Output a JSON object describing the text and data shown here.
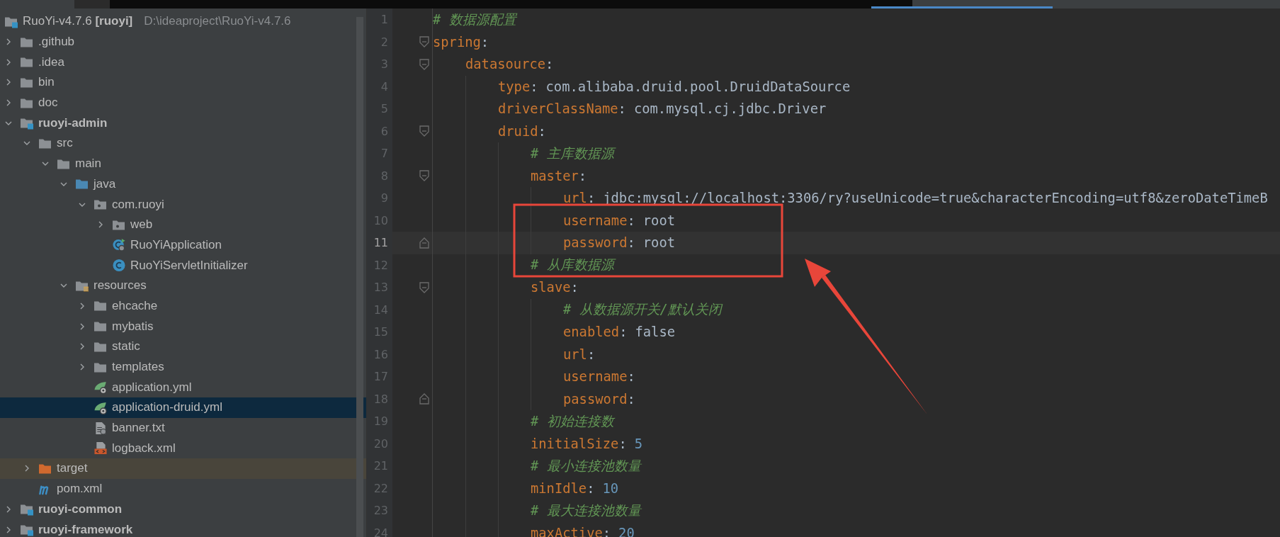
{
  "project": {
    "name": "RuoYi-v4.7.6",
    "module": "[ruoyi]",
    "path": "D:\\ideaproject\\RuoYi-v4.7.6",
    "selected": false,
    "children": [
      {
        "name": ".github",
        "kind": "folder",
        "expanded": false,
        "selected": false
      },
      {
        "name": ".idea",
        "kind": "folder",
        "expanded": false,
        "selected": false
      },
      {
        "name": "bin",
        "kind": "folder",
        "expanded": false,
        "selected": false
      },
      {
        "name": "doc",
        "kind": "folder",
        "expanded": false,
        "selected": false
      },
      {
        "name": "ruoyi-admin",
        "kind": "module",
        "expanded": true,
        "selected": false,
        "children": [
          {
            "name": "src",
            "kind": "folder",
            "expanded": true,
            "selected": false,
            "children": [
              {
                "name": "main",
                "kind": "folder",
                "expanded": true,
                "selected": false,
                "children": [
                  {
                    "name": "java",
                    "kind": "source-root",
                    "expanded": true,
                    "selected": false,
                    "children": [
                      {
                        "name": "com.ruoyi",
                        "kind": "package",
                        "expanded": true,
                        "selected": false,
                        "children": [
                          {
                            "name": "web",
                            "kind": "package",
                            "expanded": false,
                            "selected": false
                          },
                          {
                            "name": "RuoYiApplication",
                            "kind": "main-class",
                            "selected": false
                          },
                          {
                            "name": "RuoYiServletInitializer",
                            "kind": "class",
                            "selected": false
                          }
                        ]
                      }
                    ]
                  },
                  {
                    "name": "resources",
                    "kind": "resource-root",
                    "expanded": true,
                    "selected": false,
                    "children": [
                      {
                        "name": "ehcache",
                        "kind": "folder",
                        "expanded": false,
                        "selected": false
                      },
                      {
                        "name": "mybatis",
                        "kind": "folder",
                        "expanded": false,
                        "selected": false
                      },
                      {
                        "name": "static",
                        "kind": "folder",
                        "expanded": false,
                        "selected": false
                      },
                      {
                        "name": "templates",
                        "kind": "folder",
                        "expanded": false,
                        "selected": false
                      },
                      {
                        "name": "application.yml",
                        "kind": "spring-config",
                        "selected": false
                      },
                      {
                        "name": "application-druid.yml",
                        "kind": "spring-config",
                        "selected": true
                      },
                      {
                        "name": "banner.txt",
                        "kind": "text-file",
                        "selected": false
                      },
                      {
                        "name": "logback.xml",
                        "kind": "xml-file",
                        "selected": false
                      }
                    ]
                  }
                ]
              }
            ]
          },
          {
            "name": "target",
            "kind": "excluded-folder",
            "expanded": false,
            "selected": false
          },
          {
            "name": "pom.xml",
            "kind": "maven-file",
            "selected": false
          }
        ]
      },
      {
        "name": "ruoyi-common",
        "kind": "module",
        "expanded": false,
        "selected": false
      },
      {
        "name": "ruoyi-framework",
        "kind": "module",
        "expanded": false,
        "selected": false
      }
    ]
  },
  "editor": {
    "lines": [
      {
        "number": "1",
        "current": false,
        "fold_start": false,
        "fold_end": false,
        "segments": [
          {
            "kind": "comment",
            "text": "# 数据源配置"
          }
        ]
      },
      {
        "number": "2",
        "current": false,
        "fold_start": true,
        "fold_end": false,
        "segments": [
          {
            "kind": "key",
            "text": "spring"
          },
          {
            "kind": "punct",
            "text": ":"
          }
        ],
        "children": [
          {
            "number": "3",
            "current": false,
            "fold_start": true,
            "fold_end": false,
            "segments": [
              {
                "kind": "key",
                "text": "datasource"
              },
              {
                "kind": "punct",
                "text": ":"
              }
            ],
            "children": [
              {
                "number": "4",
                "current": false,
                "fold_start": false,
                "fold_end": false,
                "segments": [
                  {
                    "kind": "key",
                    "text": "type"
                  },
                  {
                    "kind": "punct",
                    "text": ":"
                  },
                  {
                    "kind": "value",
                    "text": "com.alibaba.druid.pool.DruidDataSource"
                  }
                ]
              },
              {
                "number": "5",
                "current": false,
                "fold_start": false,
                "fold_end": false,
                "segments": [
                  {
                    "kind": "key",
                    "text": "driverClassName"
                  },
                  {
                    "kind": "punct",
                    "text": ":"
                  },
                  {
                    "kind": "value",
                    "text": "com.mysql.cj.jdbc.Driver"
                  }
                ]
              },
              {
                "number": "6",
                "current": false,
                "fold_start": true,
                "fold_end": false,
                "segments": [
                  {
                    "kind": "key",
                    "text": "druid"
                  },
                  {
                    "kind": "punct",
                    "text": ":"
                  }
                ],
                "children": [
                  {
                    "number": "7",
                    "current": false,
                    "fold_start": false,
                    "fold_end": false,
                    "segments": [
                      {
                        "kind": "comment",
                        "text": "# 主库数据源"
                      }
                    ]
                  },
                  {
                    "number": "8",
                    "current": false,
                    "fold_start": true,
                    "fold_end": false,
                    "segments": [
                      {
                        "kind": "key",
                        "text": "master"
                      },
                      {
                        "kind": "punct",
                        "text": ":"
                      }
                    ],
                    "children": [
                      {
                        "number": "9",
                        "current": false,
                        "fold_start": false,
                        "fold_end": false,
                        "segments": [
                          {
                            "kind": "key",
                            "text": "url"
                          },
                          {
                            "kind": "punct",
                            "text": ":"
                          },
                          {
                            "kind": "value",
                            "text": "jdbc:mysql://localhost:3306/ry?useUnicode=true&characterEncoding=utf8&zeroDateTimeB"
                          }
                        ]
                      },
                      {
                        "number": "10",
                        "current": false,
                        "fold_start": false,
                        "fold_end": false,
                        "segments": [
                          {
                            "kind": "key",
                            "text": "username"
                          },
                          {
                            "kind": "punct",
                            "text": ":"
                          },
                          {
                            "kind": "value",
                            "text": "root"
                          }
                        ]
                      },
                      {
                        "number": "11",
                        "current": true,
                        "fold_start": false,
                        "fold_end": true,
                        "segments": [
                          {
                            "kind": "key",
                            "text": "password"
                          },
                          {
                            "kind": "punct",
                            "text": ":"
                          },
                          {
                            "kind": "value",
                            "text": "root"
                          }
                        ]
                      }
                    ]
                  },
                  {
                    "number": "12",
                    "current": false,
                    "fold_start": false,
                    "fold_end": false,
                    "segments": [
                      {
                        "kind": "comment",
                        "text": "# 从库数据源"
                      }
                    ]
                  },
                  {
                    "number": "13",
                    "current": false,
                    "fold_start": true,
                    "fold_end": false,
                    "segments": [
                      {
                        "kind": "key",
                        "text": "slave"
                      },
                      {
                        "kind": "punct",
                        "text": ":"
                      }
                    ],
                    "children": [
                      {
                        "number": "14",
                        "current": false,
                        "fold_start": false,
                        "fold_end": false,
                        "segments": [
                          {
                            "kind": "comment",
                            "text": "# 从数据源开关/默认关闭"
                          }
                        ]
                      },
                      {
                        "number": "15",
                        "current": false,
                        "fold_start": false,
                        "fold_end": false,
                        "segments": [
                          {
                            "kind": "key",
                            "text": "enabled"
                          },
                          {
                            "kind": "punct",
                            "text": ":"
                          },
                          {
                            "kind": "value",
                            "text": "false"
                          }
                        ]
                      },
                      {
                        "number": "16",
                        "current": false,
                        "fold_start": false,
                        "fold_end": false,
                        "segments": [
                          {
                            "kind": "key",
                            "text": "url"
                          },
                          {
                            "kind": "punct",
                            "text": ":"
                          }
                        ]
                      },
                      {
                        "number": "17",
                        "current": false,
                        "fold_start": false,
                        "fold_end": false,
                        "segments": [
                          {
                            "kind": "key",
                            "text": "username"
                          },
                          {
                            "kind": "punct",
                            "text": ":"
                          }
                        ]
                      },
                      {
                        "number": "18",
                        "current": false,
                        "fold_start": false,
                        "fold_end": true,
                        "segments": [
                          {
                            "kind": "key",
                            "text": "password"
                          },
                          {
                            "kind": "punct",
                            "text": ":"
                          }
                        ]
                      }
                    ]
                  },
                  {
                    "number": "19",
                    "current": false,
                    "fold_start": false,
                    "fold_end": false,
                    "segments": [
                      {
                        "kind": "comment",
                        "text": "# 初始连接数"
                      }
                    ]
                  },
                  {
                    "number": "20",
                    "current": false,
                    "fold_start": false,
                    "fold_end": false,
                    "segments": [
                      {
                        "kind": "key",
                        "text": "initialSize"
                      },
                      {
                        "kind": "punct",
                        "text": ":"
                      },
                      {
                        "kind": "number",
                        "text": "5"
                      }
                    ]
                  },
                  {
                    "number": "21",
                    "current": false,
                    "fold_start": false,
                    "fold_end": false,
                    "segments": [
                      {
                        "kind": "comment",
                        "text": "# 最小连接池数量"
                      }
                    ]
                  },
                  {
                    "number": "22",
                    "current": false,
                    "fold_start": false,
                    "fold_end": false,
                    "segments": [
                      {
                        "kind": "key",
                        "text": "minIdle"
                      },
                      {
                        "kind": "punct",
                        "text": ":"
                      },
                      {
                        "kind": "number",
                        "text": "10"
                      }
                    ]
                  },
                  {
                    "number": "23",
                    "current": false,
                    "fold_start": false,
                    "fold_end": false,
                    "segments": [
                      {
                        "kind": "comment",
                        "text": "# 最大连接池数量"
                      }
                    ]
                  },
                  {
                    "number": "24",
                    "current": false,
                    "fold_start": false,
                    "fold_end": false,
                    "segments": [
                      {
                        "kind": "key",
                        "text": "maxActive"
                      },
                      {
                        "kind": "punct",
                        "text": ":"
                      },
                      {
                        "kind": "number",
                        "text": "20"
                      }
                    ]
                  }
                ]
              }
            ]
          }
        ]
      }
    ]
  }
}
